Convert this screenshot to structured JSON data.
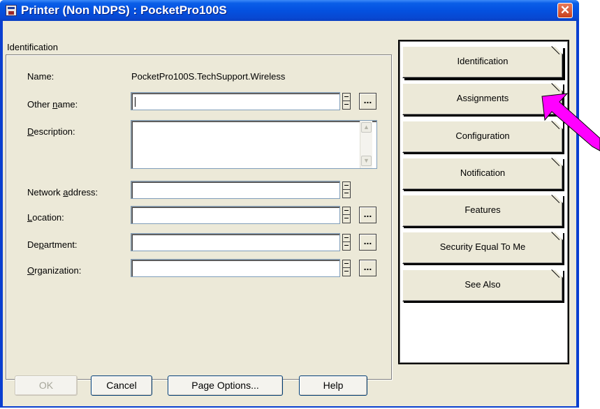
{
  "window": {
    "title": "Printer (Non NDPS) : PocketPro100S",
    "close_glyph": "✕",
    "app_icon": "printer-app-icon"
  },
  "group": {
    "title": "Identification"
  },
  "fields": {
    "name_label": "Name:",
    "name_value": "PocketPro100S.TechSupport.Wireless",
    "other_name_label": "Other name:",
    "other_name_value": "",
    "description_label": "Description:",
    "description_value": "",
    "network_address_label": "Network address:",
    "network_address_value": "",
    "location_label": "Location:",
    "location_value": "",
    "department_label": "Department:",
    "department_value": "",
    "organization_label": "Organization:",
    "organization_value": "",
    "browse_label": "..."
  },
  "tabs": [
    {
      "label": "Identification",
      "active": true
    },
    {
      "label": "Assignments"
    },
    {
      "label": "Configuration"
    },
    {
      "label": "Notification"
    },
    {
      "label": "Features"
    },
    {
      "label": "Security Equal To Me"
    },
    {
      "label": "See Also"
    }
  ],
  "buttons": {
    "ok": "OK",
    "cancel": "Cancel",
    "page_options": "Page Options...",
    "help": "Help"
  },
  "annotation": {
    "arrow_color": "#ff00ff",
    "points_to": "Assignments"
  },
  "colors": {
    "titlebar": "#0451e0",
    "dialog": "#ece9d8",
    "close": "#c8401c"
  }
}
